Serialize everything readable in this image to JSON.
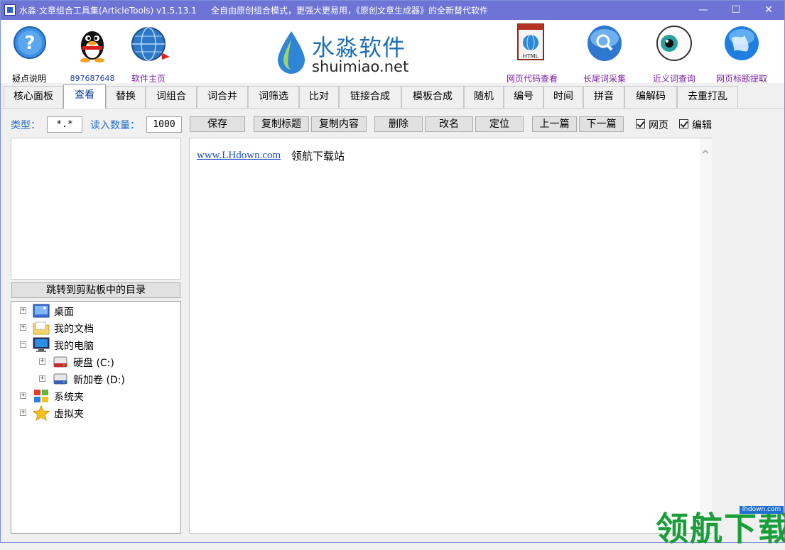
{
  "window": {
    "title": "水淼·文章组合工具集(ArticleTools) v1.5.13.1",
    "slogan": "全自由原创组合模式，更强大更易用，《原创文章生成器》的全新替代软件",
    "buttons": {
      "minimize": "—",
      "maximize": "☐",
      "close": "✕"
    }
  },
  "toolbar": {
    "help": "疑点说明",
    "qq": "897687648",
    "homepage": "软件主页",
    "logo_cn": "水淼软件",
    "logo_en": "shuimiao.net",
    "html_view": "网页代码查看",
    "longtail": "长尾词采集",
    "synonym": "近义词查询",
    "title_extract": "网页标题提取"
  },
  "tabs": [
    {
      "label": "核心面板"
    },
    {
      "label": "查看"
    },
    {
      "label": "替换"
    },
    {
      "label": "词组合"
    },
    {
      "label": "词合并"
    },
    {
      "label": "词筛选"
    },
    {
      "label": "比对"
    },
    {
      "label": "链接合成"
    },
    {
      "label": "模板合成"
    },
    {
      "label": "随机"
    },
    {
      "label": "编号"
    },
    {
      "label": "时间"
    },
    {
      "label": "拼音"
    },
    {
      "label": "编解码"
    },
    {
      "label": "去重打乱"
    }
  ],
  "active_tab": "查看",
  "controls": {
    "type_label": "类型：",
    "type_value": "*.*",
    "count_label": "读入数量：",
    "count_value": "1000",
    "save": "保存",
    "copy_title": "复制标题",
    "copy_content": "复制内容",
    "delete": "删除",
    "rename": "改名",
    "locate": "定位",
    "prev": "上一篇",
    "next": "下一篇",
    "check_web": "网页",
    "check_edit": "编辑",
    "check_web_checked": true,
    "check_edit_checked": true
  },
  "jump_button": "跳转到剪贴板中的目录",
  "tree": [
    {
      "label": "桌面",
      "icon": "desktop-icon",
      "level": 0
    },
    {
      "label": "我的文档",
      "icon": "folder-icon",
      "level": 0
    },
    {
      "label": "我的电脑",
      "icon": "computer-icon",
      "level": 0
    },
    {
      "label": "硬盘 (C:)",
      "icon": "drive-icon",
      "level": 1
    },
    {
      "label": "新加卷 (D:)",
      "icon": "drive-icon",
      "level": 1
    },
    {
      "label": "系统夹",
      "icon": "windows-icon",
      "level": 0
    },
    {
      "label": "虚拟夹",
      "icon": "star-icon",
      "level": 0
    }
  ],
  "content": {
    "link": "www.LHdown.com",
    "text": "领航下载站"
  },
  "watermark": {
    "small": "lhdown.com",
    "big": "领航下载"
  },
  "colors": {
    "titlebar": "#6e73d6",
    "label_blue": "#1f6fcc",
    "toolbar_caption": "#7a1fa2"
  }
}
